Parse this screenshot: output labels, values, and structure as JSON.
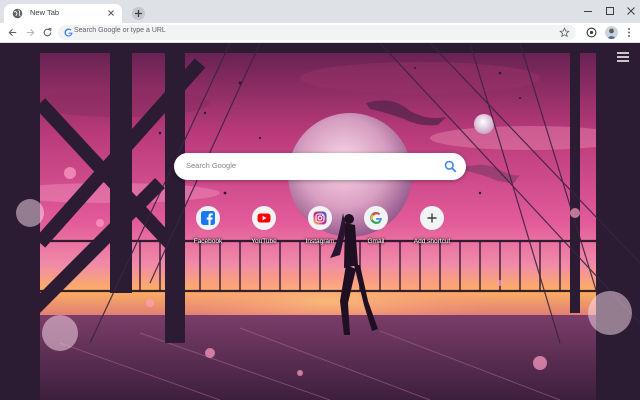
{
  "tab": {
    "title": "New Tab"
  },
  "omnibox": {
    "placeholder": "Search Google or type a URL"
  },
  "search": {
    "placeholder": "Search Google"
  },
  "shortcuts": [
    {
      "label": "Facebook",
      "icon": "facebook-icon",
      "color": "#1877f2"
    },
    {
      "label": "YouTube",
      "icon": "youtube-icon",
      "color": "#ff0000"
    },
    {
      "label": "Instagram",
      "icon": "instagram-icon",
      "color": "#c13584"
    },
    {
      "label": "Gmail",
      "icon": "google-icon",
      "color": "#4285f4"
    },
    {
      "label": "Add shortcut",
      "icon": "plus-icon",
      "color": "#3c4043"
    }
  ],
  "colors": {
    "sky": "#e85a9c",
    "sunset": "#ffb347",
    "frame": "#2b1b33"
  }
}
